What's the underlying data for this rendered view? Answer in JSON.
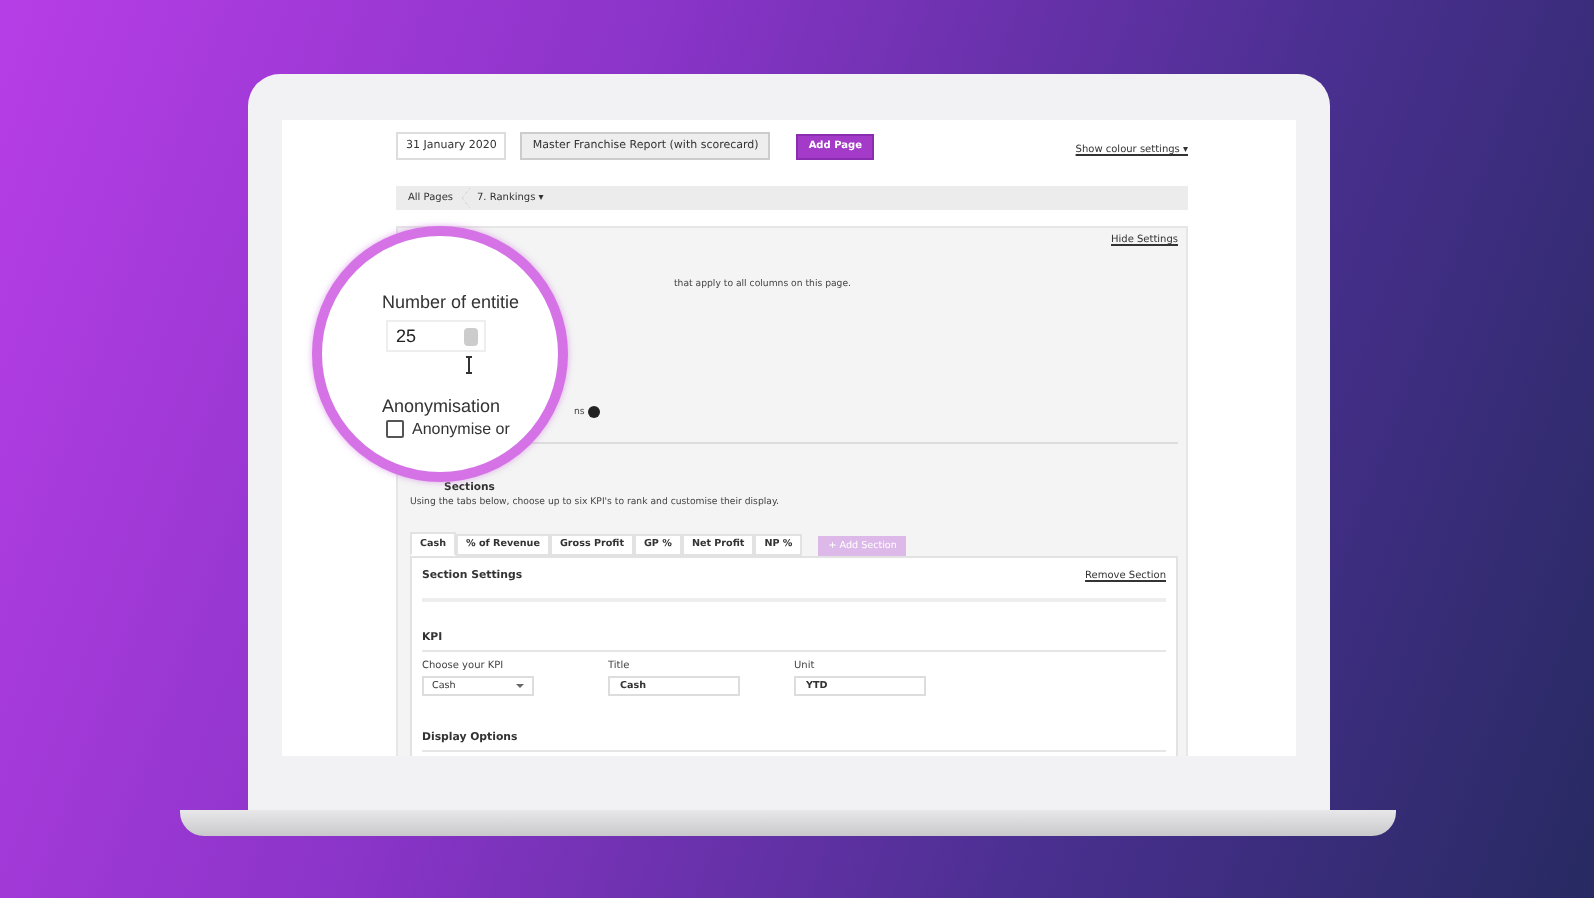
{
  "toolbar": {
    "report_date": "31 January 2020",
    "template": "Master Franchise Report (with scorecard)",
    "add_button": "Add Page",
    "colour_link": "Show colour settings ▾"
  },
  "breadcrumb": [
    {
      "label": "All Pages"
    },
    {
      "label": "7. Rankings ▾"
    }
  ],
  "settings": {
    "hide_link": "Hide Settings",
    "note": "that apply to all columns on this page.",
    "note_2": "ns",
    "heading": "Sections",
    "description": "Using the tabs below, choose up to six KPI's to rank and customise their display."
  },
  "magnifier": {
    "entities_label": "Number of entitie",
    "entities_value": "25",
    "anonymisation_heading": "Anonymisation",
    "anonymise_label": "Anonymise or",
    "anonymise_checked": false
  },
  "tabs": [
    {
      "label": "Cash",
      "selected": true
    },
    {
      "label": "% of Revenue",
      "selected": false
    },
    {
      "label": "Gross Profit",
      "selected": false
    },
    {
      "label": "GP %",
      "selected": false
    },
    {
      "label": "Net Profit",
      "selected": false
    },
    {
      "label": "NP %",
      "selected": false
    }
  ],
  "add_section": {
    "label": "+ Add Section",
    "disabled": true
  },
  "section": {
    "title": "Section Settings",
    "remove_link": "Remove Section",
    "kpi_heading": "KPI",
    "fields": [
      {
        "kind": "select",
        "label": "Choose your KPI",
        "value": "Cash"
      },
      {
        "kind": "text",
        "label": "Title",
        "value": "Cash"
      },
      {
        "kind": "text",
        "label": "Unit",
        "value": "YTD"
      }
    ],
    "display_heading": "Display Options"
  }
}
